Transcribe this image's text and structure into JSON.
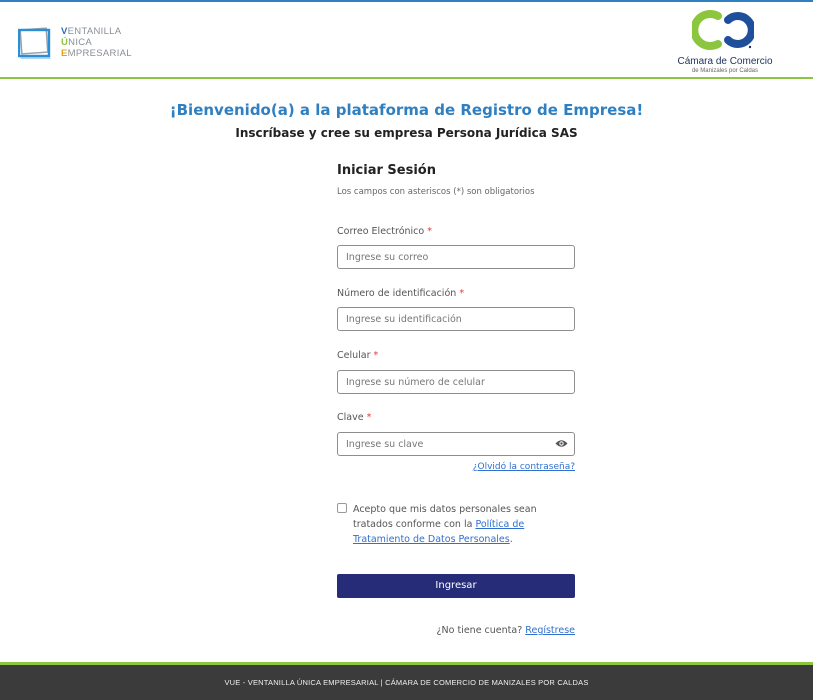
{
  "header": {
    "vue_logo": {
      "line1_initial": "V",
      "line1_rest": "ENTANILLA",
      "line2_initial": "Ú",
      "line2_rest": "NICA",
      "line3_initial": "E",
      "line3_rest": "MPRESARIAL"
    },
    "chamber_logo": {
      "name": "Cámara de Comercio",
      "sub": "de Manizales por Caldas"
    },
    "colors": {
      "top_line": "#2f7fc1",
      "separator": "#8cc63f"
    }
  },
  "welcome_title": "¡Bienvenido(a) a la plataforma de Registro de Empresa!",
  "subtitle": "Inscríbase y cree su empresa Persona Jurídica SAS",
  "login": {
    "title": "Iniciar Sesión",
    "note": "Los campos con asteriscos (*) son obligatorios",
    "required_mark": "*",
    "email": {
      "label": "Correo Electrónico",
      "placeholder": "Ingrese su correo"
    },
    "id_number": {
      "label": "Número de identificación",
      "placeholder": "Ingrese su identificación"
    },
    "phone": {
      "label": "Celular",
      "placeholder": "Ingrese su número de celular"
    },
    "password": {
      "label": "Clave",
      "placeholder": "Ingrese su clave",
      "icon": "eye-icon"
    },
    "forgot_link": "¿Olvidó la contraseña?",
    "consent": {
      "text_before": "Acepto que mis datos personales sean tratados conforme con la ",
      "link": "Política de Tratamiento de Datos Personales",
      "text_after": ".",
      "checked": false
    },
    "submit_label": "Ingresar",
    "signup_prompt": "¿No tiene cuenta?",
    "signup_link": "Regístrese"
  },
  "footer": {
    "text": "VUE - VENTANILLA ÚNICA EMPRESARIAL  |  CÁMARA DE COMERCIO DE MANIZALES POR CALDAS"
  },
  "colors": {
    "primary_blue": "#2f7fc1",
    "button": "#262c78",
    "link": "#2f6fd0",
    "required": "#e53935",
    "footer_bg": "#3b3b3b",
    "accent_green": "#8cc63f"
  }
}
